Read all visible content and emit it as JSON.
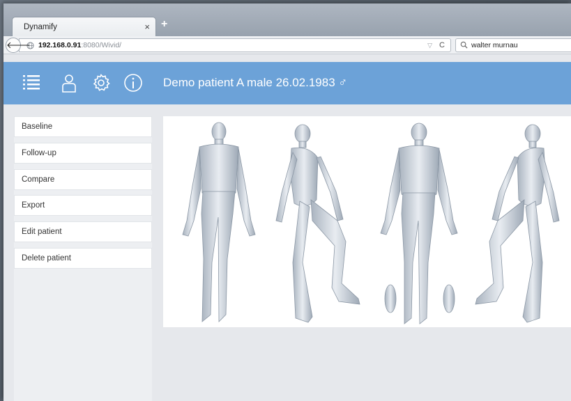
{
  "browser": {
    "tab_title": "Dynamify",
    "tab_close": "×",
    "new_tab": "+",
    "url_host": "192.168.0.91",
    "url_path": ":8080/Wivid/",
    "url_dropdown": "▽",
    "reload": "C",
    "search_value": "walter murnau"
  },
  "header": {
    "patient_title": "Demo patient A male 26.02.1983 ♂",
    "icons": [
      "list-icon",
      "user-icon",
      "gear-icon",
      "info-icon"
    ],
    "background_color": "#6ca2d8"
  },
  "sidebar": {
    "items": [
      {
        "label": "Baseline"
      },
      {
        "label": "Follow-up"
      },
      {
        "label": "Compare"
      },
      {
        "label": "Export"
      },
      {
        "label": "Edit patient"
      },
      {
        "label": "Delete patient"
      }
    ]
  },
  "main": {
    "figure_views": [
      "front-view",
      "left-side-view",
      "back-view",
      "right-side-view"
    ]
  }
}
